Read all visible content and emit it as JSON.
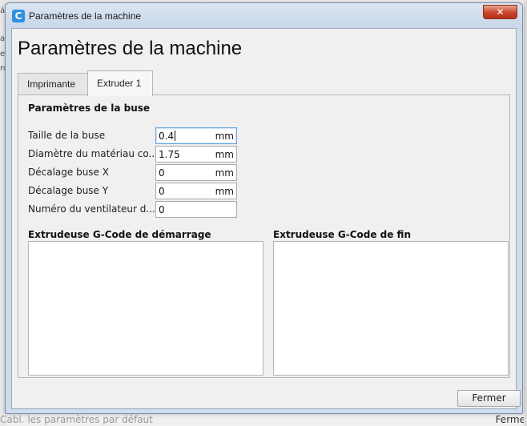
{
  "background": {
    "left_fragments": [
      "á",
      "a",
      "e",
      "ro"
    ],
    "bottom_text": "Cabl. les paramètres par défaut",
    "bottom_right_text": "Ferme"
  },
  "window": {
    "title": "Paramètres de la machine",
    "app_icon_letter": "C",
    "close_glyph": "✕"
  },
  "dialog": {
    "heading": "Paramètres de la machine",
    "tabs": [
      {
        "label": "Imprimante",
        "active": false
      },
      {
        "label": "Extruder 1",
        "active": true
      }
    ]
  },
  "nozzle_settings": {
    "title": "Paramètres de la buse",
    "fields": [
      {
        "label": "Taille de la buse",
        "value": "0.4",
        "unit": "mm"
      },
      {
        "label": "Diamètre du matériau co...",
        "value": "1.75",
        "unit": "mm"
      },
      {
        "label": "Décalage buse X",
        "value": "0",
        "unit": "mm"
      },
      {
        "label": "Décalage buse Y",
        "value": "0",
        "unit": "mm"
      },
      {
        "label": "Numéro du ventilateur d...",
        "value": "0",
        "unit": ""
      }
    ]
  },
  "gcode": {
    "start_title": "Extrudeuse G-Code de démarrage",
    "start_value": "",
    "end_title": "Extrudeuse G-Code de fin",
    "end_value": ""
  },
  "footer": {
    "close_label": "Fermer"
  },
  "colors": {
    "accent_focus": "#6aa6dc",
    "titlebar": "#cfdcec",
    "close_red": "#c7432a"
  }
}
